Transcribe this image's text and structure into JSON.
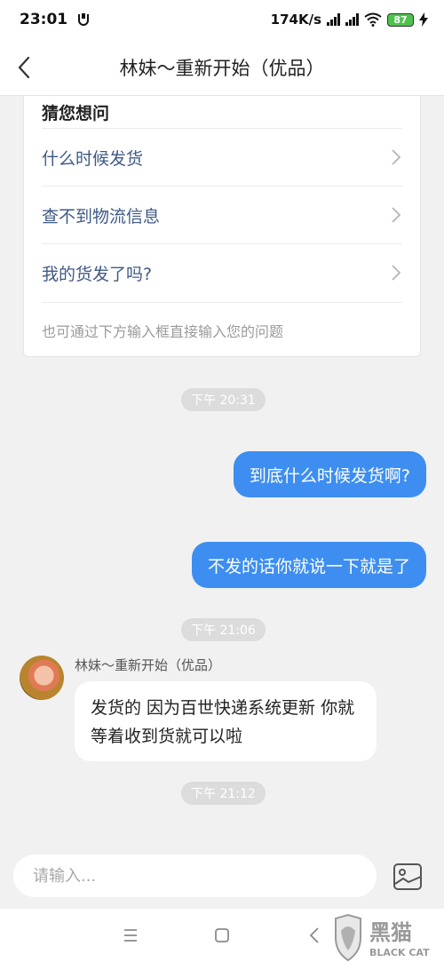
{
  "status_bar": {
    "time": "23:01",
    "network_speed": "174K/s",
    "battery_level": "87"
  },
  "header": {
    "title": "林妹～重新开始（优品）"
  },
  "suggestions": {
    "title": "猜您想问",
    "items": [
      {
        "label": "什么时候发货"
      },
      {
        "label": "查不到物流信息"
      },
      {
        "label": "我的货发了吗?"
      }
    ],
    "hint": "也可通过下方输入框直接输入您的问题"
  },
  "messages": {
    "time1": "下午 20:31",
    "out1": "到底什么时候发货啊?",
    "out2": "不发的话你就说一下就是了",
    "time2": "下午 21:06",
    "sender_name": "林妹～重新开始（优品）",
    "in1": "发货的 因为百世快递系统更新 你就等着收到货就可以啦",
    "time3": "下午 21:12"
  },
  "input": {
    "placeholder": "请输入..."
  },
  "watermark": {
    "brand_cn": "黑猫",
    "brand_en": "BLACK CAT"
  },
  "colors": {
    "accent": "#3d8ef0",
    "link_text": "#3f5a84",
    "background": "#f1f1f1"
  }
}
